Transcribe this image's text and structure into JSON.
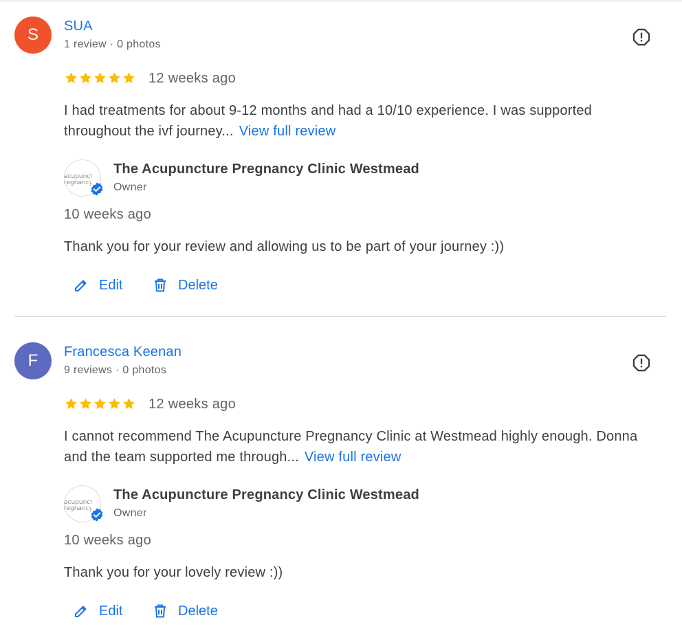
{
  "reviews": [
    {
      "avatar_letter": "S",
      "avatar_color": "#f0522d",
      "reviewer_name": "SUA",
      "reviewer_meta": "1 review · 0 photos",
      "rating": 5,
      "date": "12 weeks ago",
      "text": "I had treatments for about 9-12 months and had a 10/10 experience. I was supported throughout the ivf journey...",
      "view_full_label": "View full review",
      "owner": {
        "logo_text": "acupuncture\nregnancy cl",
        "name": "The Acupuncture Pregnancy Clinic Westmead",
        "role": "Owner",
        "reply_date": "10 weeks ago",
        "reply_text": "Thank you for your review and allowing us to be part of your journey :))"
      },
      "edit_label": "Edit",
      "delete_label": "Delete"
    },
    {
      "avatar_letter": "F",
      "avatar_color": "#5c6bc0",
      "reviewer_name": "Francesca Keenan",
      "reviewer_meta": "9 reviews · 0 photos",
      "rating": 5,
      "date": "12 weeks ago",
      "text": "I cannot recommend The Acupuncture Pregnancy Clinic at Westmead highly enough. Donna and the team supported me through...",
      "view_full_label": "View full review",
      "owner": {
        "logo_text": "acupuncture\nregnancy cl",
        "name": "The Acupuncture Pregnancy Clinic Westmead",
        "role": "Owner",
        "reply_date": "10 weeks ago",
        "reply_text": "Thank you for your lovely review :))"
      },
      "edit_label": "Edit",
      "delete_label": "Delete"
    }
  ],
  "colors": {
    "link": "#1a73e8",
    "star": "#fbbc04",
    "text": "#3c4043",
    "secondary": "#5f6368",
    "divider": "#dadce0"
  },
  "icons": {
    "report": "report-octagon-icon",
    "star": "star-icon",
    "verified": "verified-check-icon",
    "edit": "pencil-icon",
    "delete": "trash-icon"
  }
}
